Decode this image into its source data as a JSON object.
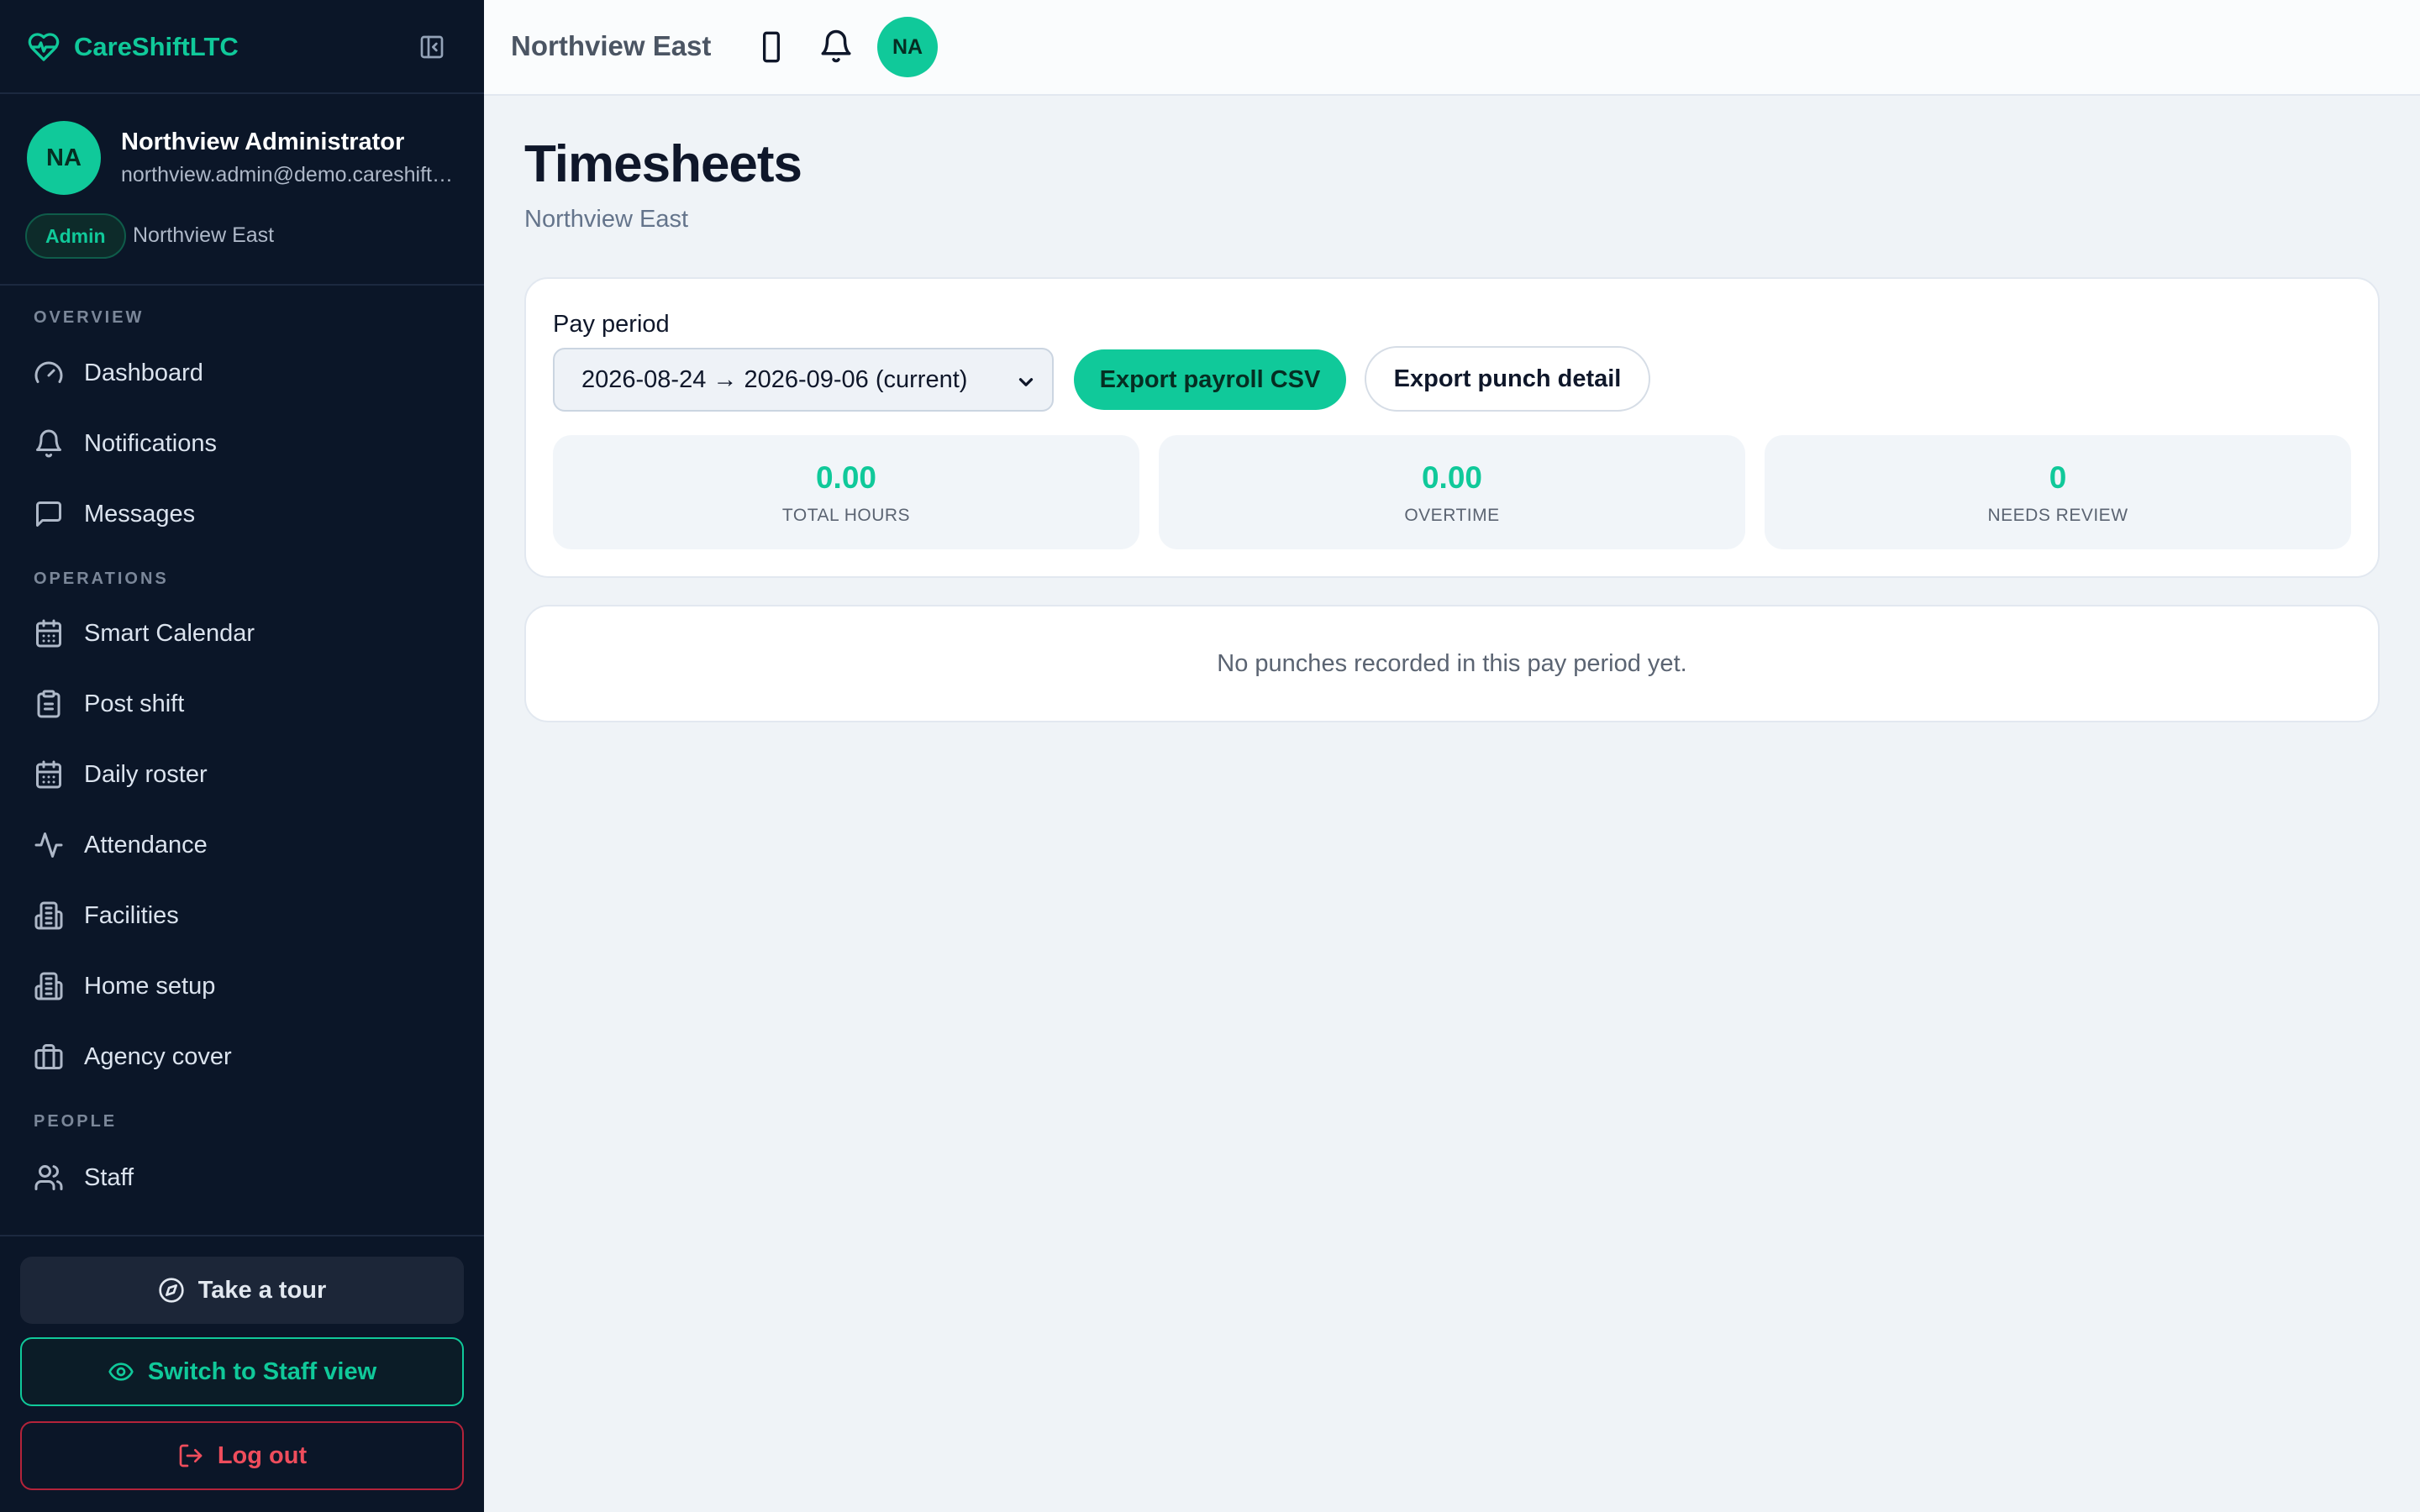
{
  "brand": {
    "name": "CareShiftLTC"
  },
  "profile": {
    "initials": "NA",
    "name": "Northview Administrator",
    "email": "northview.admin@demo.careshift.app",
    "role": "Admin",
    "facility": "Northview East"
  },
  "sidebar": {
    "sections": [
      {
        "label": "OVERVIEW"
      },
      {
        "label": "OPERATIONS"
      },
      {
        "label": "PEOPLE"
      }
    ],
    "items": [
      {
        "label": "Dashboard",
        "icon": "gauge-icon"
      },
      {
        "label": "Notifications",
        "icon": "bell-icon"
      },
      {
        "label": "Messages",
        "icon": "message-icon"
      },
      {
        "label": "Smart Calendar",
        "icon": "calendar-icon"
      },
      {
        "label": "Post shift",
        "icon": "clipboard-icon"
      },
      {
        "label": "Daily roster",
        "icon": "calendar-icon"
      },
      {
        "label": "Attendance",
        "icon": "activity-icon"
      },
      {
        "label": "Facilities",
        "icon": "building-icon"
      },
      {
        "label": "Home setup",
        "icon": "building-icon"
      },
      {
        "label": "Agency cover",
        "icon": "briefcase-icon"
      },
      {
        "label": "Staff",
        "icon": "users-icon"
      }
    ],
    "tour_label": "Take a tour",
    "switch_label": "Switch to Staff view",
    "logout_label": "Log out"
  },
  "topbar": {
    "title": "Northview East",
    "avatar_initials": "NA"
  },
  "main": {
    "title": "Timesheets",
    "subtitle": "Northview East",
    "pay_period_label": "Pay period",
    "pay_period_value": "2026-08-24 → 2026-09-06 (current)",
    "export_csv_label": "Export payroll CSV",
    "export_punch_label": "Export punch detail",
    "stats": [
      {
        "value": "0.00",
        "label": "TOTAL HOURS"
      },
      {
        "value": "0.00",
        "label": "OVERTIME"
      },
      {
        "value": "0",
        "label": "NEEDS REVIEW"
      }
    ],
    "empty_message": "No punches recorded in this pay period yet."
  },
  "colors": {
    "accent": "#10c99a",
    "sidebar_bg": "#0b1628",
    "page_bg": "#eff3f7",
    "danger": "#ef4d5c"
  }
}
